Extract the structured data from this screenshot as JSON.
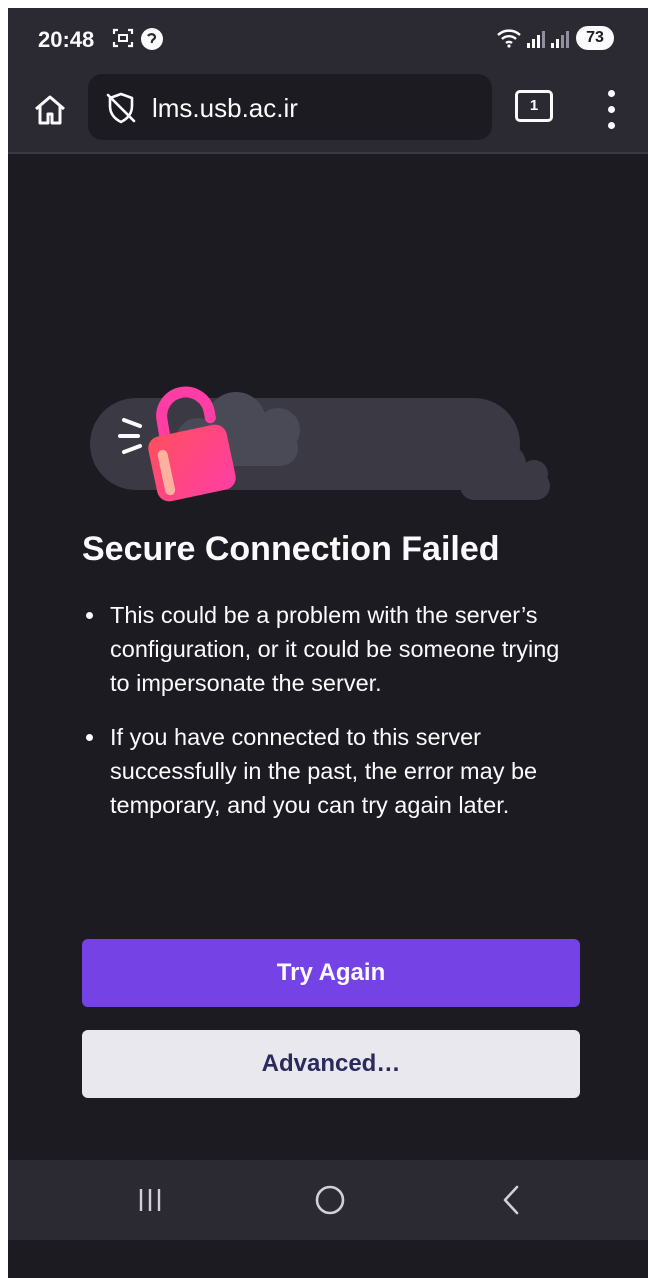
{
  "status_bar": {
    "time": "20:48",
    "battery": "73",
    "icons": [
      "screenshot-icon",
      "notification-badge-icon",
      "wifi-icon",
      "signal-icon",
      "signal-icon"
    ]
  },
  "toolbar": {
    "url": "lms.usb.ac.ir",
    "tab_count": "1",
    "icons": [
      "home-icon",
      "shield-slash-icon",
      "tabs-icon",
      "menu-icon"
    ]
  },
  "error": {
    "title": "Secure Connection Failed",
    "bullets": [
      "This could be a problem with the server’s configuration, or it could be someone trying to impersonate the server.",
      "If you have connected to this server successfully in the past, the error may be temporary, and you can try again later."
    ],
    "try_again_label": "Try Again",
    "advanced_label": "Advanced…"
  },
  "nav_bar": {
    "icons": [
      "recent-apps-icon",
      "home-circle-icon",
      "back-icon"
    ]
  },
  "colors": {
    "background": "#1c1b22",
    "toolbar": "#2b2a33",
    "primary_button": "#7542e5",
    "secondary_button": "#e8e8ee",
    "lock_gradient_start": "#ff4f5e",
    "lock_gradient_end": "#ff3ea5"
  }
}
